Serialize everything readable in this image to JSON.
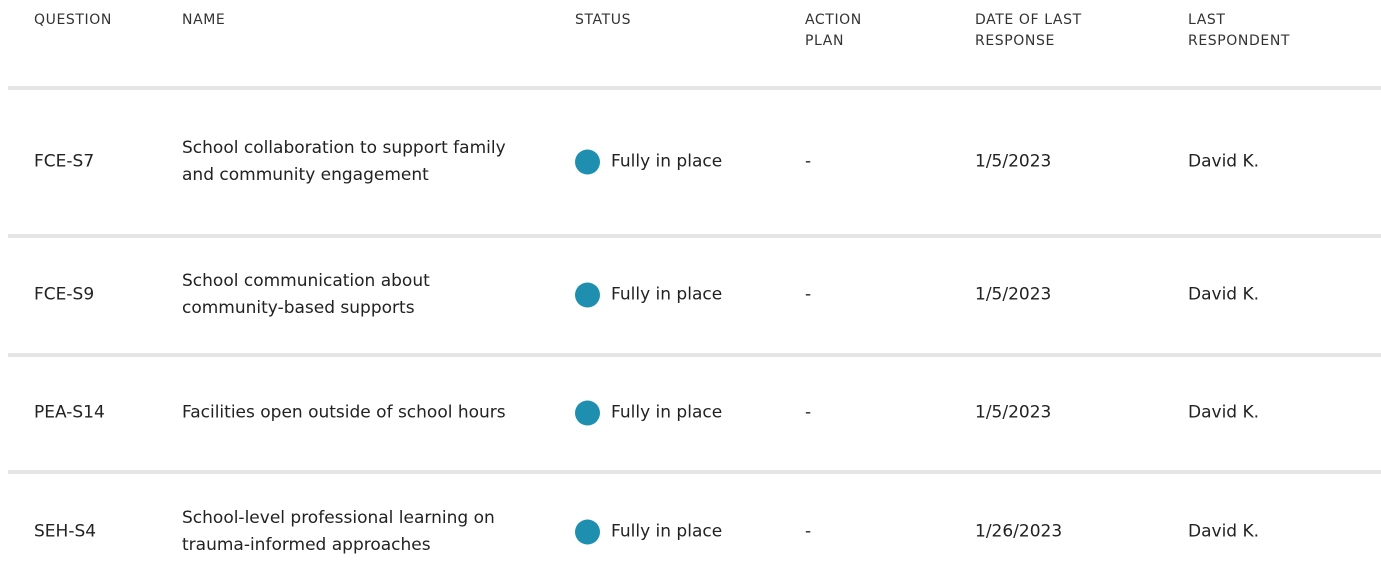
{
  "columns": {
    "question": "QUESTION",
    "name": "NAME",
    "status": "STATUS",
    "action_plan": "ACTION PLAN",
    "date": "DATE OF LAST RESPONSE",
    "respondent": "LAST RESPONDENT"
  },
  "status_color": "#1f8fb0",
  "divider_color": "#e5e5e5",
  "rows": [
    {
      "question": "FCE-S7",
      "name": "School collaboration to support family and community engagement",
      "status": "Fully in place",
      "action_plan": "-",
      "date": "1/5/2023",
      "respondent": "David K."
    },
    {
      "question": "FCE-S9",
      "name": "School communication about community-based supports",
      "status": "Fully in place",
      "action_plan": "-",
      "date": "1/5/2023",
      "respondent": "David K."
    },
    {
      "question": "PEA-S14",
      "name": "Facilities open outside of school hours",
      "status": "Fully in place",
      "action_plan": "-",
      "date": "1/5/2023",
      "respondent": "David K."
    },
    {
      "question": "SEH-S4",
      "name": "School-level professional learning on trauma-informed approaches",
      "status": "Fully in place",
      "action_plan": "-",
      "date": "1/26/2023",
      "respondent": "David K."
    }
  ]
}
